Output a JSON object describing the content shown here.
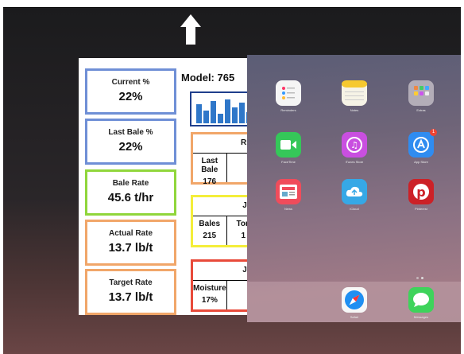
{
  "app_switcher": {
    "gesture_hint_icon": "up-arrow-icon"
  },
  "monitor_app": {
    "model_label": "Model: 765",
    "tiles": [
      {
        "label": "Current %",
        "value": "22%",
        "color": "#6f8fd6"
      },
      {
        "label": "Last Bale %",
        "value": "22%",
        "color": "#6f8fd6"
      },
      {
        "label": "Bale Rate",
        "value": "45.6 t/hr",
        "color": "#90d63b"
      },
      {
        "label": "Actual Rate",
        "value": "13.7 lb/t",
        "color": "#f1a669"
      },
      {
        "label": "Target Rate",
        "value": "13.7 lb/t",
        "color": "#f1a669"
      }
    ],
    "rfv_panel": {
      "title": "RFV",
      "cells": [
        {
          "label": "Last Bale",
          "value": "176"
        },
        {
          "label": "",
          "value": ""
        }
      ]
    },
    "job_panel_1": {
      "title": "Job",
      "cells": [
        {
          "label": "Bales",
          "value": "215"
        },
        {
          "label": "Ton",
          "value": "1"
        }
      ]
    },
    "job_panel_2": {
      "title": "Job",
      "cells": [
        {
          "label": "Moisture",
          "value": "17%"
        },
        {
          "label": "",
          "value": ""
        }
      ]
    }
  },
  "home_screen": {
    "apps": [
      {
        "name": "Reminders",
        "icon": "reminders-icon",
        "color": "#f5f5f5"
      },
      {
        "name": "Notes",
        "icon": "notes-icon",
        "color": "#f6f3e6"
      },
      {
        "name": "Extras",
        "icon": "folder-icon",
        "color": "#b3adb8"
      },
      {
        "name": "FaceTime",
        "icon": "facetime-icon",
        "color": "#35c759"
      },
      {
        "name": "iTunes Store",
        "icon": "itunes-icon",
        "color": "#c94fe0"
      },
      {
        "name": "App Store",
        "icon": "app-store-icon",
        "color": "#2f8cf0",
        "badge": "1"
      },
      {
        "name": "News",
        "icon": "news-icon",
        "color": "#f04c5b"
      },
      {
        "name": "iCloud",
        "icon": "icloud-icon",
        "color": "#36a8e6"
      },
      {
        "name": "Pinterest",
        "icon": "pinterest-icon",
        "color": "#cc2127"
      }
    ],
    "dock": [
      {
        "name": "Safari",
        "icon": "safari-icon",
        "color": "#1f8ff2"
      },
      {
        "name": "Messages",
        "icon": "messages-icon",
        "color": "#3ed35b"
      }
    ]
  }
}
